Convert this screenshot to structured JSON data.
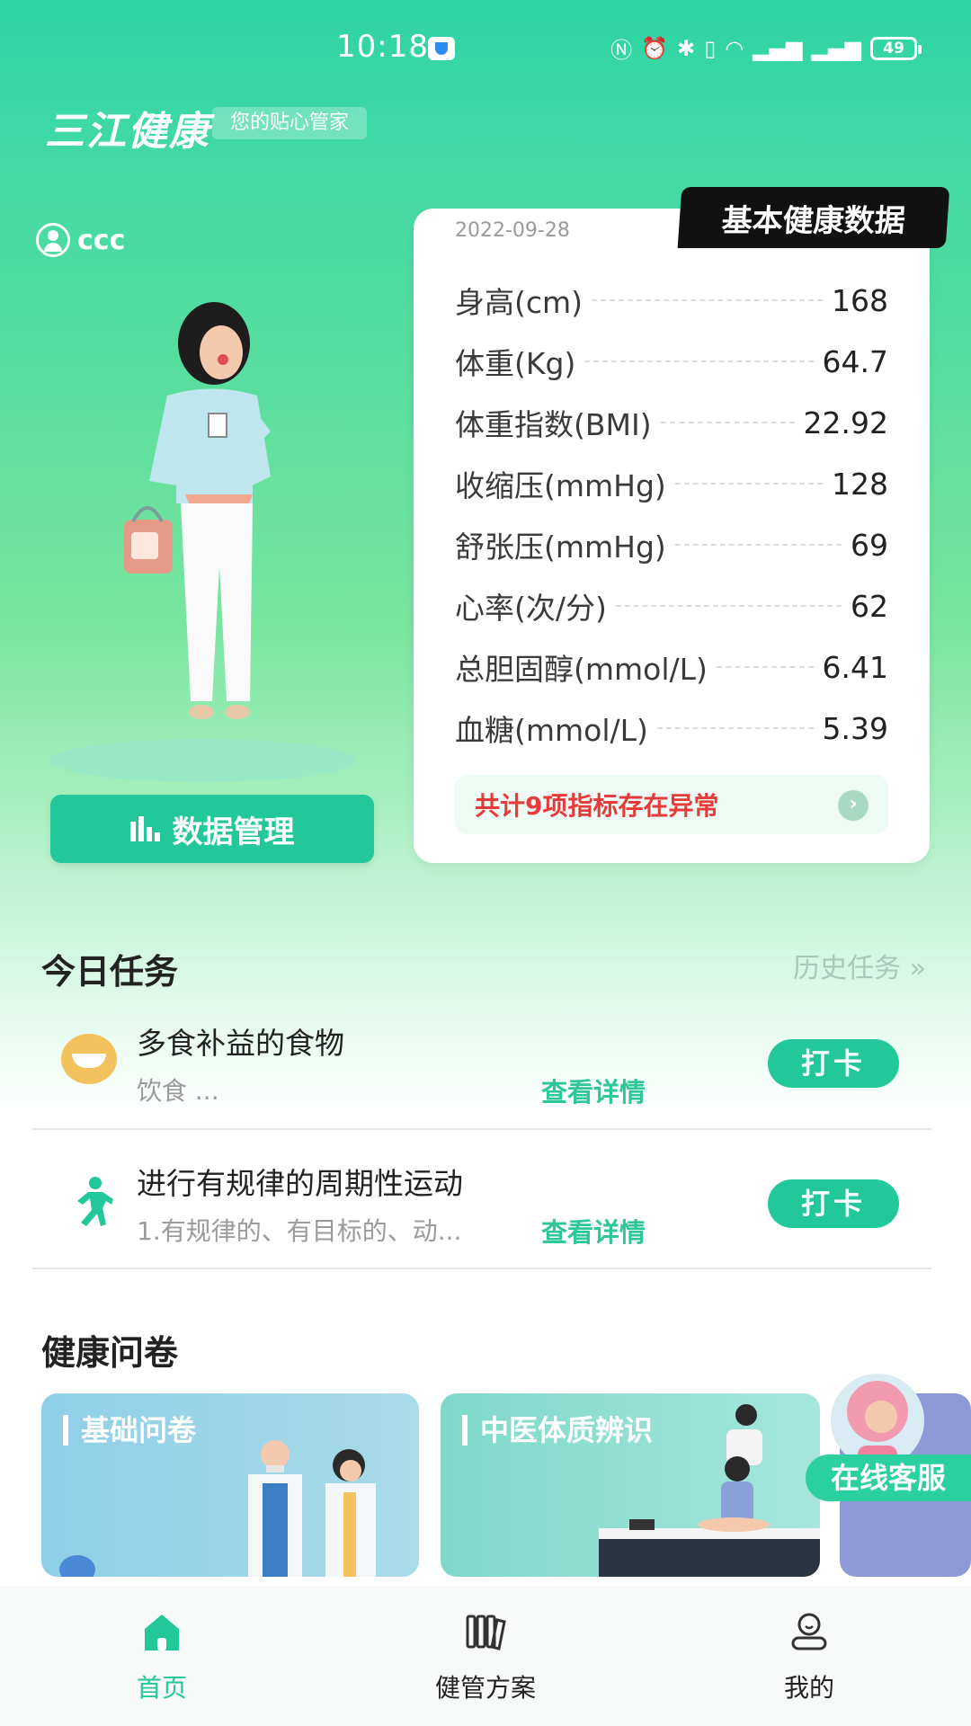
{
  "status_bar": {
    "time": "10:18",
    "battery": "49"
  },
  "header": {
    "app_name": "三江健康",
    "tagline": "您的贴心管家"
  },
  "user": {
    "name": "ccc"
  },
  "data_manage_button": "数据管理",
  "health_card": {
    "badge": "基本健康数据",
    "date": "2022-09-28",
    "metrics": [
      {
        "label": "身高(cm)",
        "value": "168"
      },
      {
        "label": "体重(Kg)",
        "value": "64.7"
      },
      {
        "label": "体重指数(BMI)",
        "value": "22.92"
      },
      {
        "label": "收缩压(mmHg)",
        "value": "128"
      },
      {
        "label": "舒张压(mmHg)",
        "value": "69"
      },
      {
        "label": "心率(次/分)",
        "value": "62"
      },
      {
        "label": "总胆固醇(mmol/L)",
        "value": "6.41"
      },
      {
        "label": "血糖(mmol/L)",
        "value": "5.39"
      }
    ],
    "alert": "共计9项指标存在异常"
  },
  "tasks": {
    "title": "今日任务",
    "history_link": "历史任务 »",
    "items": [
      {
        "title": "多食补益的食物",
        "desc": "饮食 ...",
        "detail": "查看详情",
        "button": "打卡",
        "icon": "food-bowl-icon"
      },
      {
        "title": "进行有规律的周期性运动",
        "desc": "1.有规律的、有目标的、动...",
        "detail": "查看详情",
        "button": "打卡",
        "icon": "running-icon"
      }
    ]
  },
  "questionnaire": {
    "title": "健康问卷",
    "cards": [
      {
        "title": "基础问卷"
      },
      {
        "title": "中医体质辨识"
      }
    ]
  },
  "customer_service": {
    "label": "在线客服"
  },
  "bottom_nav": {
    "items": [
      {
        "label": "首页",
        "icon": "home-icon",
        "active": true
      },
      {
        "label": "健管方案",
        "icon": "books-icon",
        "active": false
      },
      {
        "label": "我的",
        "icon": "user-icon",
        "active": false
      }
    ]
  },
  "colors": {
    "primary": "#22c79a",
    "alert": "#e63b3b",
    "link": "#2ec79a"
  }
}
